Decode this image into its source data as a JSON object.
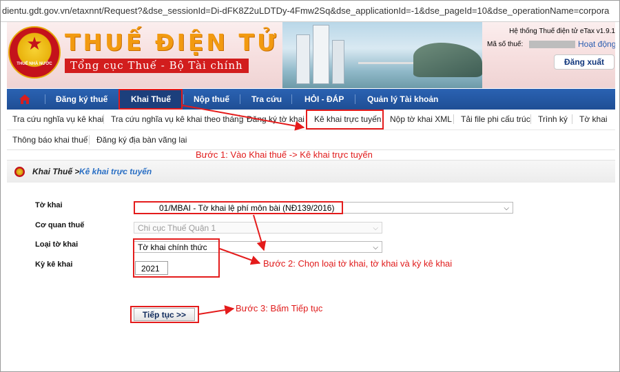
{
  "browser": {
    "url": "dientu.gdt.gov.vn/etaxnnt/Request?&dse_sessionId=Di-dFK8Z2uLDTDy-4Fmw2Sq&dse_applicationId=-1&dse_pageId=10&dse_operationName=corpora"
  },
  "header": {
    "emblem_text": "THUẾ NHÀ NƯỚC",
    "brand_title": "THUẾ ĐIỆN TỬ",
    "brand_subtitle": "Tổng cục Thuế - Bộ Tài chính",
    "system_version": "Hệ thống Thuế điện tử eTax v1.9.1",
    "tax_code_label": "Mã số thuế:",
    "status_link": "Hoạt động",
    "logout_label": "Đăng xuất"
  },
  "nav": {
    "items": [
      "Đăng ký thuế",
      "Khai Thuế",
      "Nộp thuế",
      "Tra cứu",
      "HỎI - ĐÁP",
      "Quản lý Tài khoản"
    ],
    "active": "Khai Thuế"
  },
  "subnav": {
    "row1": [
      "Tra cứu nghĩa vụ kê khai",
      "Tra cứu nghĩa vụ kê khai theo tháng",
      "Đăng ký tờ khai",
      "Kê khai trực tuyến",
      "Nộp tờ khai XML",
      "Tải file phi cấu trúc",
      "Trình ký",
      "Tờ khai"
    ],
    "row2": [
      "Thông báo khai thuế",
      "Đăng ký địa bàn vãng lai"
    ]
  },
  "annotations": {
    "step1": "Bước 1: Vào Khai thuế -> Kê khai trực tuyến",
    "step2": "Bước 2: Chọn loại tờ khai, tờ khai và kỳ kê khai",
    "step3": "Bước 3: Bấm Tiếp tục"
  },
  "breadcrumb": {
    "parent": "Khai Thuế >",
    "current": "Kê khai trực tuyến"
  },
  "form": {
    "to_khai": {
      "label": "Tờ khai",
      "value": "01/MBAI - Tờ khai lệ phí môn bài (NĐ139/2016)"
    },
    "co_quan_thue": {
      "label": "Cơ quan thuế",
      "value": "Chi cục Thuế Quận 1"
    },
    "loai_to_khai": {
      "label": "Loại tờ khai",
      "value": "Tờ khai chính thức"
    },
    "ky_ke_khai": {
      "label": "Kỳ kê khai",
      "value": "2021"
    },
    "submit_label": "Tiếp tục >>"
  },
  "colors": {
    "nav_bg": "#1f4e95",
    "annotation_red": "#e01b1b",
    "brand_orange": "#f29a10",
    "link_blue": "#2a6fc4"
  }
}
